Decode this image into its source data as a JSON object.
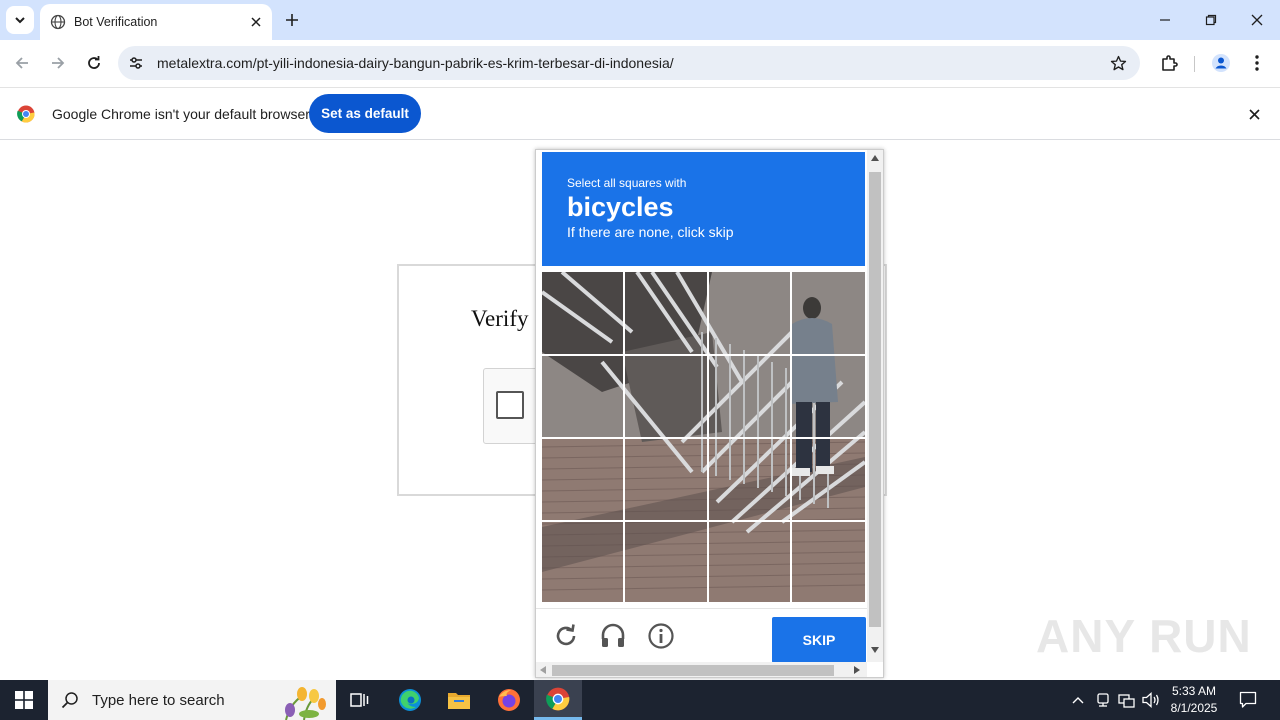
{
  "browser": {
    "tab_title": "Bot Verification",
    "url": "metalextra.com/pt-yili-indonesia-dairy-bangun-pabrik-es-krim-terbesar-di-indonesia/"
  },
  "infobar": {
    "message": "Google Chrome isn't your default browser",
    "button": "Set as default"
  },
  "page": {
    "heading": "Verify"
  },
  "challenge": {
    "instruction": "Select all squares with",
    "target": "bicycles",
    "hint": "If there are none, click skip",
    "skip_label": "SKIP",
    "grid_rows": 4,
    "grid_cols": 4
  },
  "watermark": "ANY RUN",
  "taskbar": {
    "search_placeholder": "Type here to search",
    "time": "5:33 AM",
    "date": "8/1/2025"
  },
  "colors": {
    "tabstrip": "#d3e3fd",
    "accent": "#0b57d0",
    "challenge_blue": "#1a73e8",
    "taskbar": "#1c2330"
  }
}
